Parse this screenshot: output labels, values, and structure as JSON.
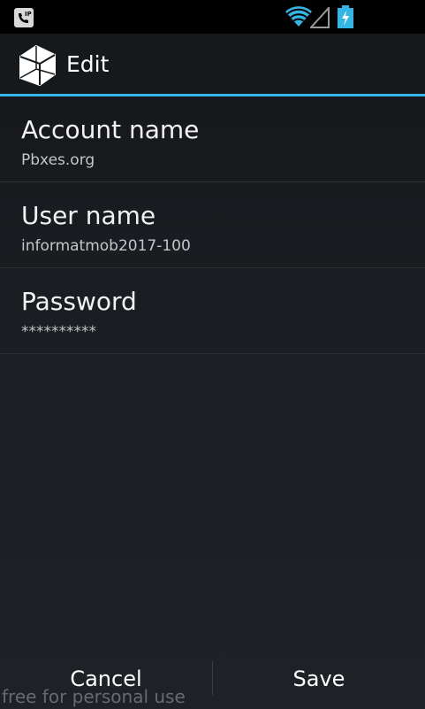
{
  "action_bar": {
    "title": "Edit"
  },
  "fields": [
    {
      "label": "Account name",
      "value": "Pbxes.org"
    },
    {
      "label": "User name",
      "value": "informatmob2017-100"
    },
    {
      "label": "Password",
      "value": "**********"
    }
  ],
  "buttons": {
    "cancel": "Cancel",
    "save": "Save"
  },
  "watermark": "free for personal use",
  "colors": {
    "accent": "#33b5e5",
    "battery": "#33b5e5",
    "wifi": "#33b5e5"
  },
  "icons": [
    "sip-phone-icon",
    "wifi-icon",
    "signal-icon",
    "battery-charging-icon",
    "app-cube-icon"
  ]
}
